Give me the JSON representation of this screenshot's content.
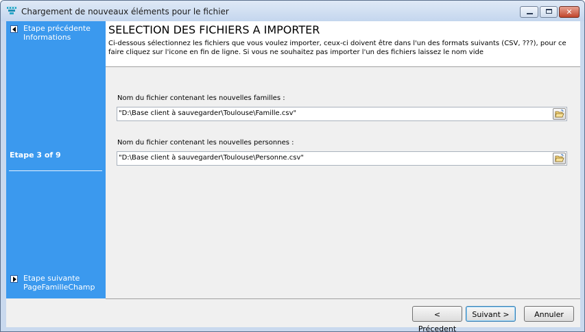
{
  "window": {
    "title": "Chargement de nouveaux éléments pour le fichier",
    "controls": {
      "minimize": "minimize",
      "maximize": "maximize",
      "close": "✕"
    }
  },
  "sidebar": {
    "prev_step": {
      "line1": "Etape précédente",
      "line2": "Informations"
    },
    "step_indicator": "Etape 3 of 9",
    "next_step": {
      "line1": "Etape suivante",
      "line2": "PageFamilleChamp"
    }
  },
  "header": {
    "title": "SELECTION DES FICHIERS A IMPORTER",
    "description": "Ci-dessous sélectionnez les fichiers que vous voulez importer, ceux-ci doivent être dans l'un des formats suivants (CSV, ???), pour ce faire cliquez sur l'icone en fin de ligne. Si vous ne souhaitez pas importer l'un des fichiers laissez le nom vide"
  },
  "fields": [
    {
      "label": "Nom du fichier contenant les nouvelles familles :",
      "value": "\"D:\\Base client à sauvegarder\\Toulouse\\Famille.csv\""
    },
    {
      "label": "Nom du fichier contenant les nouvelles personnes :",
      "value": "\"D:\\Base client à sauvegarder\\Toulouse\\Personne.csv\""
    }
  ],
  "buttons": {
    "previous": "< Précedent",
    "next": "Suivant >",
    "cancel": "Annuler"
  },
  "colors": {
    "sidebar": "#3b99ee",
    "titlebar": "#c4d6ee",
    "close_button": "#c0452c"
  }
}
